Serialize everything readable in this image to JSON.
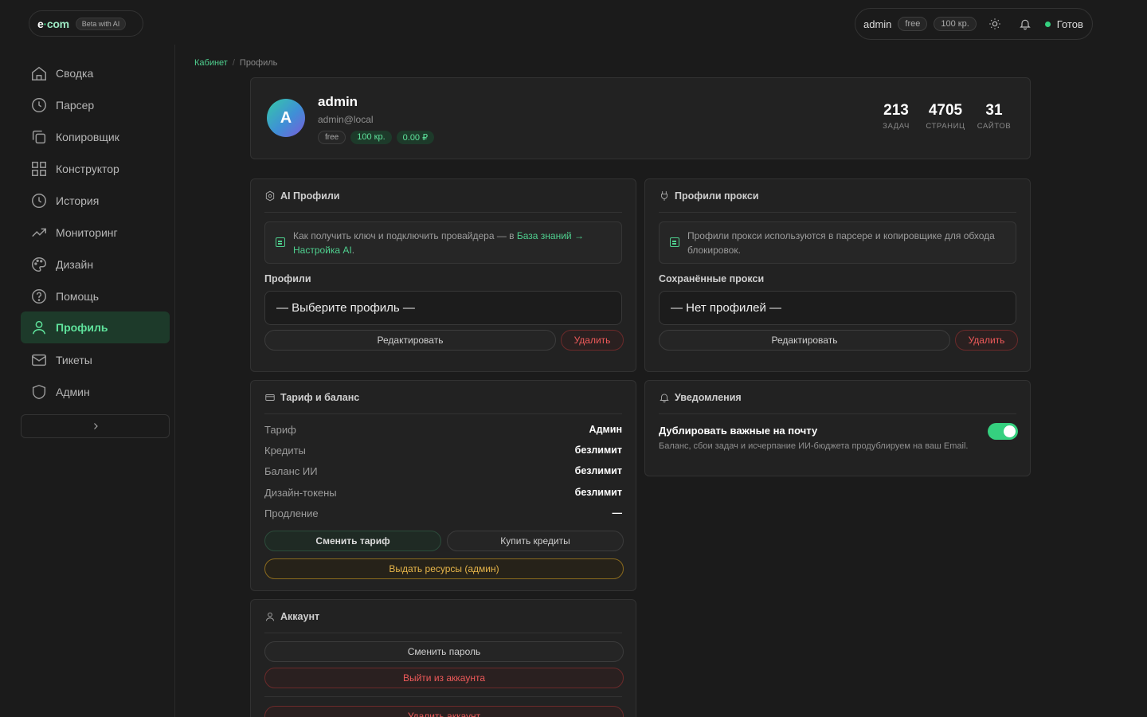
{
  "brand": {
    "logo_e": "e",
    "logo_dot": "·",
    "logo_com": "com",
    "beta": "Beta with AI"
  },
  "topbar": {
    "user": "admin",
    "plan": "free",
    "credits": "100 кр.",
    "status": "Готов"
  },
  "sidebar": {
    "items": [
      {
        "label": "Сводка",
        "icon": "home-icon"
      },
      {
        "label": "Парсер",
        "icon": "clock-icon"
      },
      {
        "label": "Копировщик",
        "icon": "copy-icon"
      },
      {
        "label": "Конструктор",
        "icon": "grid-icon"
      },
      {
        "label": "История",
        "icon": "history-icon"
      },
      {
        "label": "Мониторинг",
        "icon": "trend-icon"
      },
      {
        "label": "Дизайн",
        "icon": "palette-icon"
      },
      {
        "label": "Помощь",
        "icon": "help-icon"
      },
      {
        "label": "Профиль",
        "icon": "user-icon",
        "active": true
      },
      {
        "label": "Тикеты",
        "icon": "mail-icon"
      },
      {
        "label": "Админ",
        "icon": "shield-icon"
      }
    ],
    "collapse": "›"
  },
  "breadcrumb": {
    "root": "Кабинет",
    "sep": "/",
    "current": "Профиль"
  },
  "profile": {
    "avatar_letter": "A",
    "name": "admin",
    "email": "admin@local",
    "tags": [
      "free",
      "100 кр.",
      "0.00 ₽"
    ],
    "stats": [
      {
        "value": "213",
        "label": "ЗАДАЧ"
      },
      {
        "value": "4705",
        "label": "СТРАНИЦ"
      },
      {
        "value": "31",
        "label": "САЙТОВ"
      }
    ]
  },
  "ai_profiles": {
    "title": "AI Профили",
    "info_text": "Как получить ключ и подключить провайдера — в ",
    "info_link": "База знаний → Настройка AI",
    "info_end": ".",
    "field_label": "Профили",
    "select_value": "— Выберите профиль —",
    "edit": "Редактировать",
    "delete": "Удалить"
  },
  "proxy_profiles": {
    "title": "Профили прокси",
    "info_text": "Профили прокси используются в парсере и копировщике для обхода блокировок.",
    "field_label": "Сохранённые прокси",
    "select_value": "— Нет профилей —",
    "edit": "Редактировать",
    "delete": "Удалить"
  },
  "tariff": {
    "title": "Тариф и баланс",
    "rows": [
      {
        "k": "Тариф",
        "v": "Админ"
      },
      {
        "k": "Кредиты",
        "v": "безлимит"
      },
      {
        "k": "Баланс ИИ",
        "v": "безлимит"
      },
      {
        "k": "Дизайн-токены",
        "v": "безлимит"
      },
      {
        "k": "Продление",
        "v": "—"
      }
    ],
    "change": "Сменить тариф",
    "buy": "Купить кредиты",
    "grant": "Выдать ресурсы (админ)"
  },
  "notifications": {
    "title": "Уведомления",
    "option_title": "Дублировать важные на почту",
    "option_desc": "Баланс, сбои задач и исчерпание ИИ-бюджета продублируем на ваш Email.",
    "enabled": true
  },
  "account": {
    "title": "Аккаунт",
    "change_password": "Сменить пароль",
    "logout": "Выйти из аккаунта",
    "delete": "Удалить аккаунт"
  }
}
